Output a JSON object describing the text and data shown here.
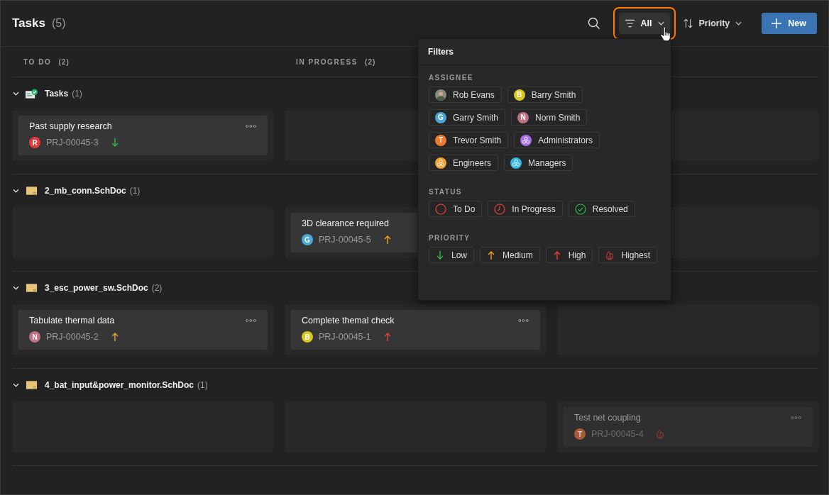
{
  "header": {
    "title": "Tasks",
    "count": "(5)"
  },
  "toolbar": {
    "filter": {
      "label": "All",
      "highlighted": true
    },
    "sort": {
      "label": "Priority"
    },
    "new_button": {
      "label": "New"
    }
  },
  "columns": [
    {
      "label": "TO DO",
      "count": "(2)"
    },
    {
      "label": "IN PROGRESS",
      "count": "(2)"
    }
  ],
  "groups": [
    {
      "name": "Tasks",
      "count": "(1)",
      "kind": "tasks",
      "expanded": true,
      "cells": [
        {
          "kind": "card",
          "task": {
            "title": "Past supply research",
            "avatar": {
              "letter": "R",
              "color": "#e5383b"
            },
            "id": "PRJ-00045-3",
            "priority": {
              "kind": "low"
            },
            "faded": false
          }
        },
        {
          "kind": "empty"
        },
        {
          "kind": "empty"
        }
      ]
    },
    {
      "name": "2_mb_conn.SchDoc",
      "count": "(1)",
      "kind": "schdoc",
      "expanded": true,
      "cells": [
        {
          "kind": "empty"
        },
        {
          "kind": "card",
          "task": {
            "title": "3D clearance required",
            "avatar": {
              "letter": "G",
              "color": "#4aa8d8"
            },
            "id": "PRJ-00045-5",
            "priority": {
              "kind": "medium"
            },
            "faded": false
          }
        },
        {
          "kind": "empty"
        }
      ]
    },
    {
      "name": "3_esc_power_sw.SchDoc",
      "count": "(2)",
      "kind": "schdoc",
      "expanded": true,
      "cells": [
        {
          "kind": "card",
          "task": {
            "title": "Tabulate thermal data",
            "avatar": {
              "letter": "N",
              "color": "#c07080"
            },
            "id": "PRJ-00045-2",
            "priority": {
              "kind": "medium"
            },
            "faded": false
          }
        },
        {
          "kind": "card",
          "task": {
            "title": "Complete themal check",
            "avatar": {
              "letter": "B",
              "color": "#d9c61c"
            },
            "id": "PRJ-00045-1",
            "priority": {
              "kind": "high"
            },
            "faded": false
          }
        },
        {
          "kind": "empty"
        }
      ]
    },
    {
      "name": "4_bat_input&power_monitor.SchDoc",
      "count": "(1)",
      "kind": "schdoc",
      "expanded": true,
      "cells": [
        {
          "kind": "empty"
        },
        {
          "kind": "empty"
        },
        {
          "kind": "card",
          "task": {
            "title": "Test net coupling",
            "avatar": {
              "letter": "T",
              "color": "#a85a36"
            },
            "id": "PRJ-00045-4",
            "priority": {
              "kind": "highest"
            },
            "faded": true
          }
        }
      ]
    }
  ],
  "filters": {
    "title": "Filters",
    "sections": [
      {
        "heading": "ASSIGNEE",
        "chips": [
          {
            "label": "Rob Evans",
            "kind": "photo"
          },
          {
            "label": "Barry Smith",
            "kind": "avatar",
            "letter": "B",
            "color": "#d9c61c"
          },
          {
            "label": "Garry Smith",
            "kind": "avatar",
            "letter": "G",
            "color": "#4aa8d8"
          },
          {
            "label": "Norm Smith",
            "kind": "avatar",
            "letter": "N",
            "color": "#c07080"
          },
          {
            "label": "Trevor Smith",
            "kind": "avatar",
            "letter": "T",
            "color": "#f07a30"
          },
          {
            "label": "Administrators",
            "kind": "group",
            "color": "#a66ee8"
          },
          {
            "label": "Engineers",
            "kind": "group",
            "color": "#f5a030"
          },
          {
            "label": "Managers",
            "kind": "group",
            "color": "#30b8e0"
          }
        ]
      },
      {
        "heading": "STATUS",
        "chips": [
          {
            "label": "To Do",
            "kind": "todo"
          },
          {
            "label": "In Progress",
            "kind": "progress"
          },
          {
            "label": "Resolved",
            "kind": "resolved"
          }
        ]
      },
      {
        "heading": "PRIORITY",
        "chips": [
          {
            "label": "Low",
            "kind": "low"
          },
          {
            "label": "Medium",
            "kind": "medium"
          },
          {
            "label": "High",
            "kind": "high"
          },
          {
            "label": "Highest",
            "kind": "highest"
          }
        ]
      }
    ]
  }
}
